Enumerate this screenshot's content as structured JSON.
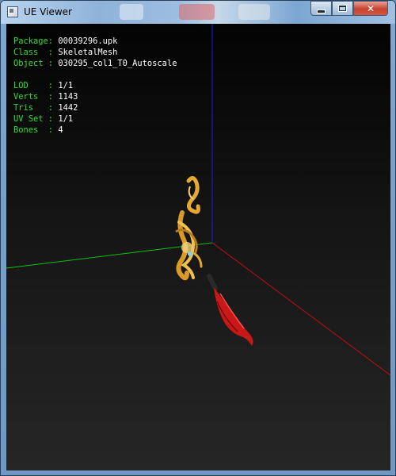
{
  "window": {
    "title": "UE Viewer",
    "controls": {
      "minimize": "",
      "maximize": "",
      "close": "✕"
    }
  },
  "info_panel": {
    "package": {
      "label": "Package:",
      "value": "00039296.upk"
    },
    "class": {
      "label": "Class  :",
      "value": "SkeletalMesh"
    },
    "object": {
      "label": "Object :",
      "value": "030295_col1_T0_Autoscale"
    },
    "lod": {
      "label": "LOD    :",
      "value": "1/1"
    },
    "verts": {
      "label": "Verts  :",
      "value": "1143"
    },
    "tris": {
      "label": "Tris   :",
      "value": "1442"
    },
    "uv_set": {
      "label": "UV Set :",
      "value": "1/1"
    },
    "bones": {
      "label": "Bones  :",
      "value": "4"
    }
  },
  "colors": {
    "label": "#2fe02f",
    "value": "#ffffff",
    "axis_x": "#c01010",
    "axis_y": "#10c010",
    "axis_z": "#2020e0",
    "mesh_gold": "#e0a030",
    "mesh_red": "#c81818"
  }
}
